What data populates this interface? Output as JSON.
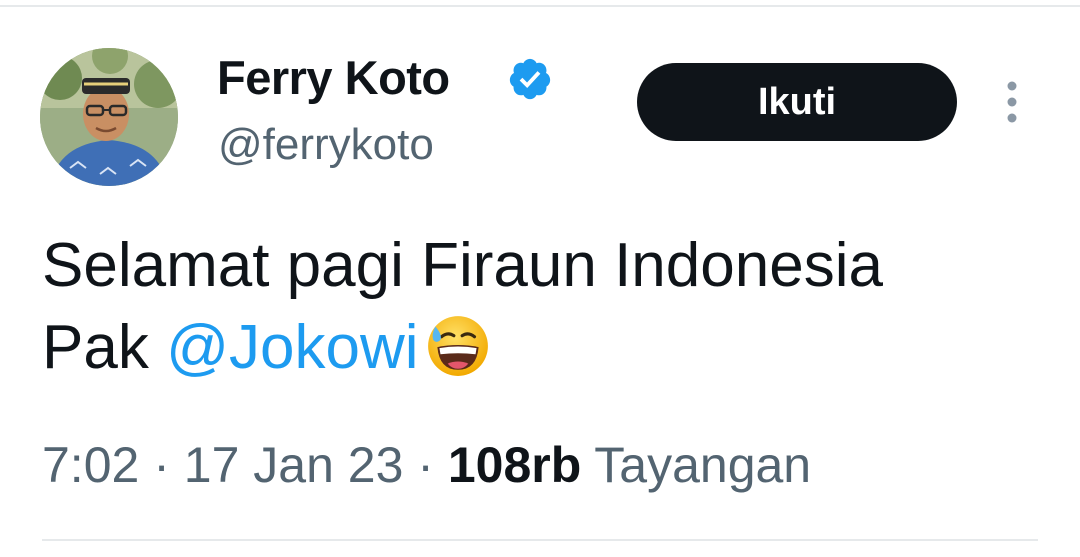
{
  "author": {
    "display_name": "Ferry Koto",
    "handle": "@ferrykoto",
    "verified": true
  },
  "follow_button": {
    "label": "Ikuti"
  },
  "tweet": {
    "line1": "Selamat pagi Firaun Indonesia",
    "line2_prefix": "Pak ",
    "mention": "@Jokowi",
    "emoji": "grinning-face-with-sweat"
  },
  "meta": {
    "time": "7:02",
    "sep1": " · ",
    "date": "17 Jan 23",
    "sep2": " · ",
    "views_count": "108rb",
    "views_label": " Tayangan"
  },
  "colors": {
    "accent": "#1d9bf0",
    "text_primary": "#0f1419",
    "text_secondary": "#536471",
    "button_bg": "#0f1419"
  }
}
